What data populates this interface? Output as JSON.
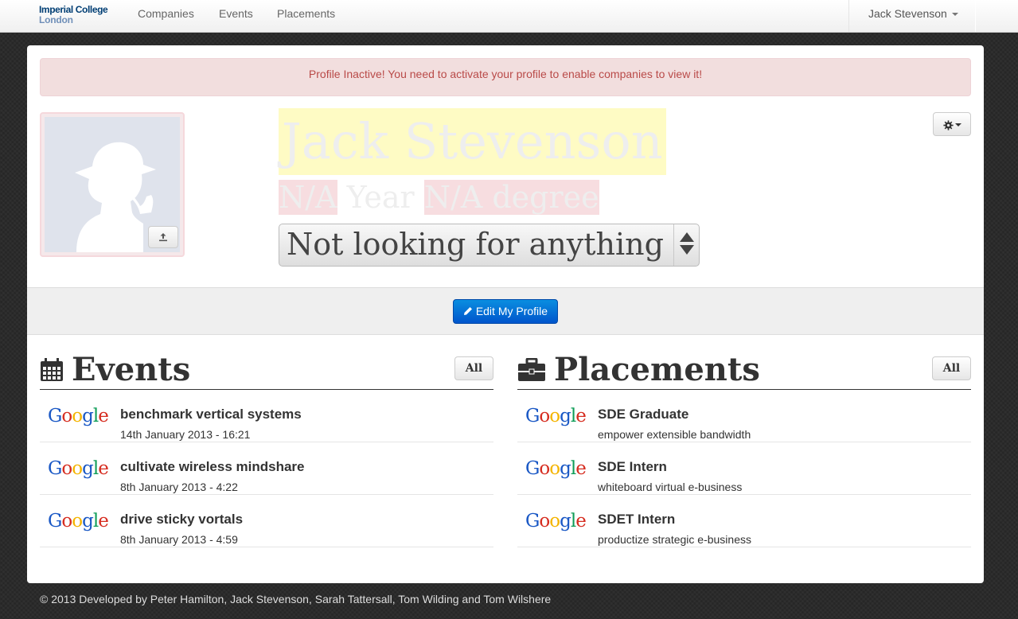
{
  "navbar": {
    "brand_line1": "Imperial College",
    "brand_line2": "London",
    "links": [
      "Companies",
      "Events",
      "Placements"
    ],
    "user_name": "Jack Stevenson"
  },
  "alert": {
    "text": "Profile Inactive! You need to activate your profile to enable companies to view it!"
  },
  "profile": {
    "name": "Jack Stevenson",
    "year_value": "N/A",
    "year_label": "Year",
    "degree_value": "N/A degree",
    "status": "Not looking for anything",
    "edit_label": "Edit My Profile"
  },
  "events": {
    "title": "Events",
    "all_label": "All",
    "items": [
      {
        "company": "Google",
        "title": "benchmark vertical systems",
        "subtitle": "14th January 2013 - 16:21"
      },
      {
        "company": "Google",
        "title": "cultivate wireless mindshare",
        "subtitle": "8th January 2013 - 4:22"
      },
      {
        "company": "Google",
        "title": "drive sticky vortals",
        "subtitle": "8th January 2013 - 4:59"
      }
    ]
  },
  "placements": {
    "title": "Placements",
    "all_label": "All",
    "items": [
      {
        "company": "Google",
        "title": "SDE Graduate",
        "subtitle": "empower extensible bandwidth"
      },
      {
        "company": "Google",
        "title": "SDE Intern",
        "subtitle": "whiteboard virtual e-business"
      },
      {
        "company": "Google",
        "title": "SDET Intern",
        "subtitle": "productize strategic e-business"
      }
    ]
  },
  "footer": {
    "text": "© 2013 Developed by Peter Hamilton, Jack Stevenson, Sarah Tattersall, Tom Wilding and Tom Wilshere"
  },
  "icons": {
    "calendar": "calendar-icon",
    "briefcase": "briefcase-icon",
    "gear": "gear-icon",
    "upload": "upload-icon",
    "pencil": "pencil-icon"
  },
  "colors": {
    "primary": "#0062cc",
    "alert_bg": "#f2dede",
    "alert_text": "#b94a48",
    "name_highlight": "#fefbc4",
    "degree_highlight": "#f7dde0"
  }
}
